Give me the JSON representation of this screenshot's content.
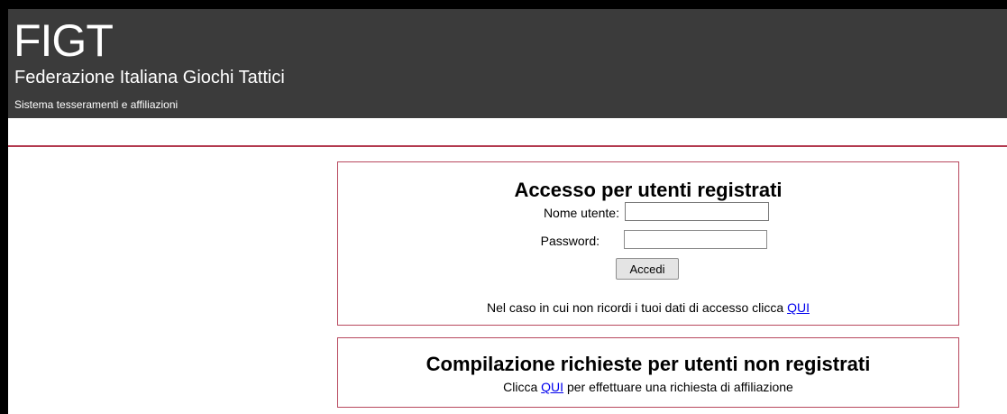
{
  "header": {
    "logo": "FIGT",
    "org_name": "Federazione Italiana Giochi Tattici",
    "system_name": "Sistema tesseramenti e affiliazioni"
  },
  "login": {
    "title": "Accesso per utenti registrati",
    "username_label": "Nome utente:",
    "username_value": "",
    "password_label": "Password:",
    "password_value": "",
    "submit_label": "Accedi",
    "forgot_text": "Nel caso in cui non ricordi i tuoi dati di accesso clicca",
    "forgot_link": "QUI"
  },
  "request": {
    "title": "Compilazione richieste per utenti non registrati",
    "prefix": "Clicca",
    "link": "QUI",
    "suffix": "per effettuare una richiesta di affiliazione"
  },
  "colors": {
    "header_bg": "#3b3b3b",
    "accent": "#b33a4f",
    "link": "#0000ee"
  }
}
